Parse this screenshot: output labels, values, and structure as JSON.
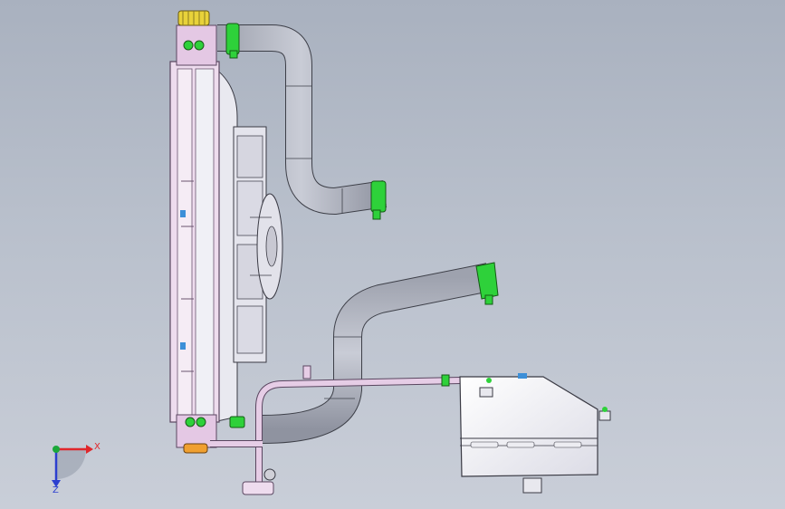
{
  "viewport": {
    "background_top": "#a9b1bf",
    "background_bottom": "#c9ced8"
  },
  "colors": {
    "hose": "#b3b7c4",
    "hose_edge": "#3d3f48",
    "clamp": "#2ed13a",
    "radiator_frame": "#e6c8e6",
    "radiator_edge": "#5a4660",
    "cap_yellow": "#e8d23a",
    "tank": "#f4f4f8",
    "pipe_pink": "#d9b7d9",
    "axis_x": "#e0272b",
    "axis_y": "#1aa83a",
    "axis_z": "#2c3fcf"
  },
  "triad": {
    "x_label": "X",
    "z_label": "Z",
    "x_icon": "x-axis-arrow-icon",
    "y_icon": "y-axis-dot-icon",
    "z_icon": "z-axis-arrow-icon"
  }
}
